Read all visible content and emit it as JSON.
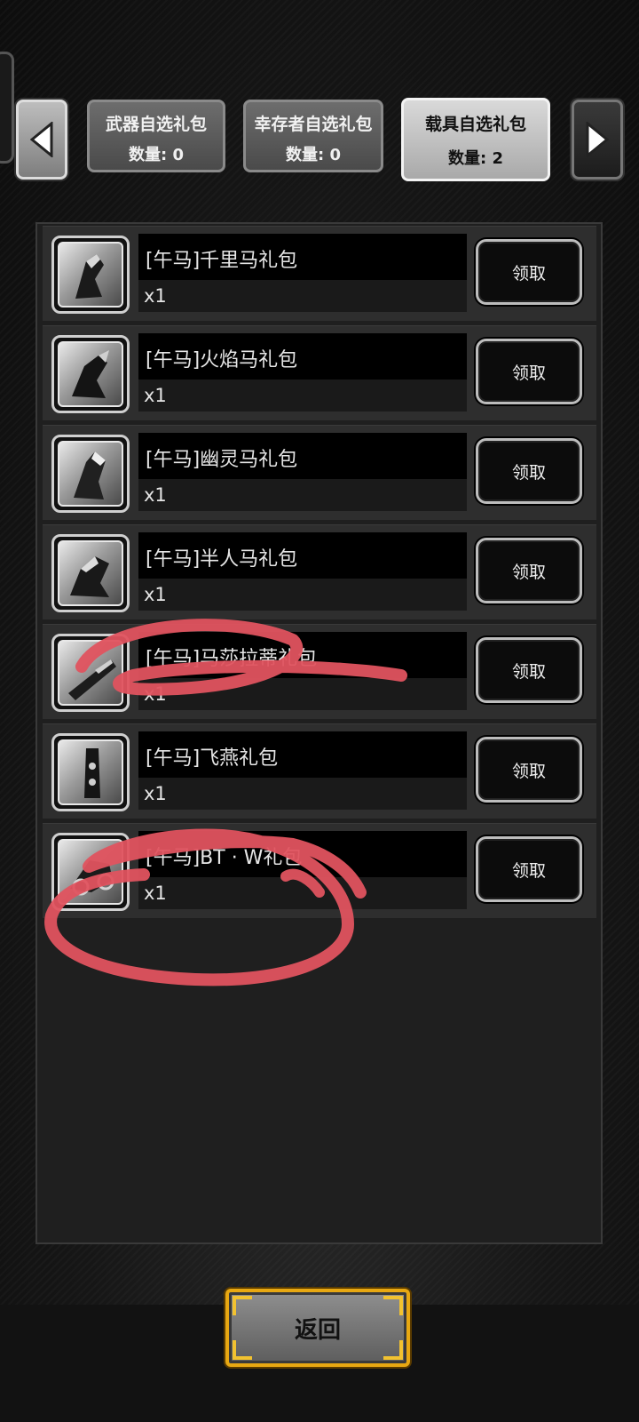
{
  "tabs": [
    {
      "title": "武器自选礼包",
      "count": "数量: 0",
      "active": false
    },
    {
      "title": "幸存者自选礼包",
      "count": "数量: 0",
      "active": false
    },
    {
      "title": "载具自选礼包",
      "count": "数量: 2",
      "active": true
    }
  ],
  "items": [
    {
      "name": "[午马]千里马礼包",
      "qty": "x1",
      "button": "领取"
    },
    {
      "name": "[午马]火焰马礼包",
      "qty": "x1",
      "button": "领取"
    },
    {
      "name": "[午马]幽灵马礼包",
      "qty": "x1",
      "button": "领取"
    },
    {
      "name": "[午马]半人马礼包",
      "qty": "x1",
      "button": "领取"
    },
    {
      "name": "[午马]马莎拉蒂礼包",
      "qty": "x1",
      "button": "领取"
    },
    {
      "name": "[午马]飞燕礼包",
      "qty": "x1",
      "button": "领取"
    },
    {
      "name": "[午马]BT · W礼包",
      "qty": "x1",
      "button": "领取"
    }
  ],
  "back_button": "返回",
  "colors": {
    "accent_gold": "#e8a812",
    "scribble_red": "#e0535f"
  },
  "icons": {
    "prev": "triangle-left-icon",
    "next": "triangle-right-icon",
    "item": "mount-icon"
  }
}
